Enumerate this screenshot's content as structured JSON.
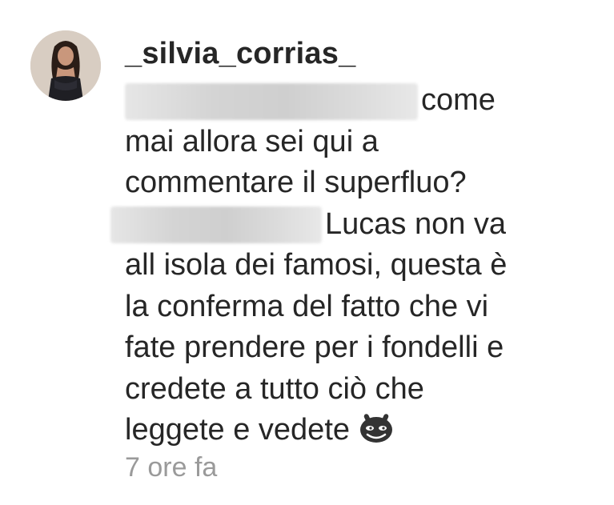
{
  "comment": {
    "username": "_silvia_corrias_",
    "avatar_icon": "profile-photo",
    "line1_text": "come",
    "line2_text": "mai allora sei qui a",
    "line3_text": "commentare il superfluo?",
    "line4_text": "Lucas non va",
    "line5_text": "all isola dei famosi, questa è",
    "line6_text": "la conferma del fatto che vi",
    "line7_text": "fate prendere per i fondelli e",
    "line8_text": "credete a tutto ciò che",
    "line9_text": "leggete e vedete",
    "emoji_icon": "mocking-face-emoji-icon",
    "timestamp": "7 ore fa"
  }
}
